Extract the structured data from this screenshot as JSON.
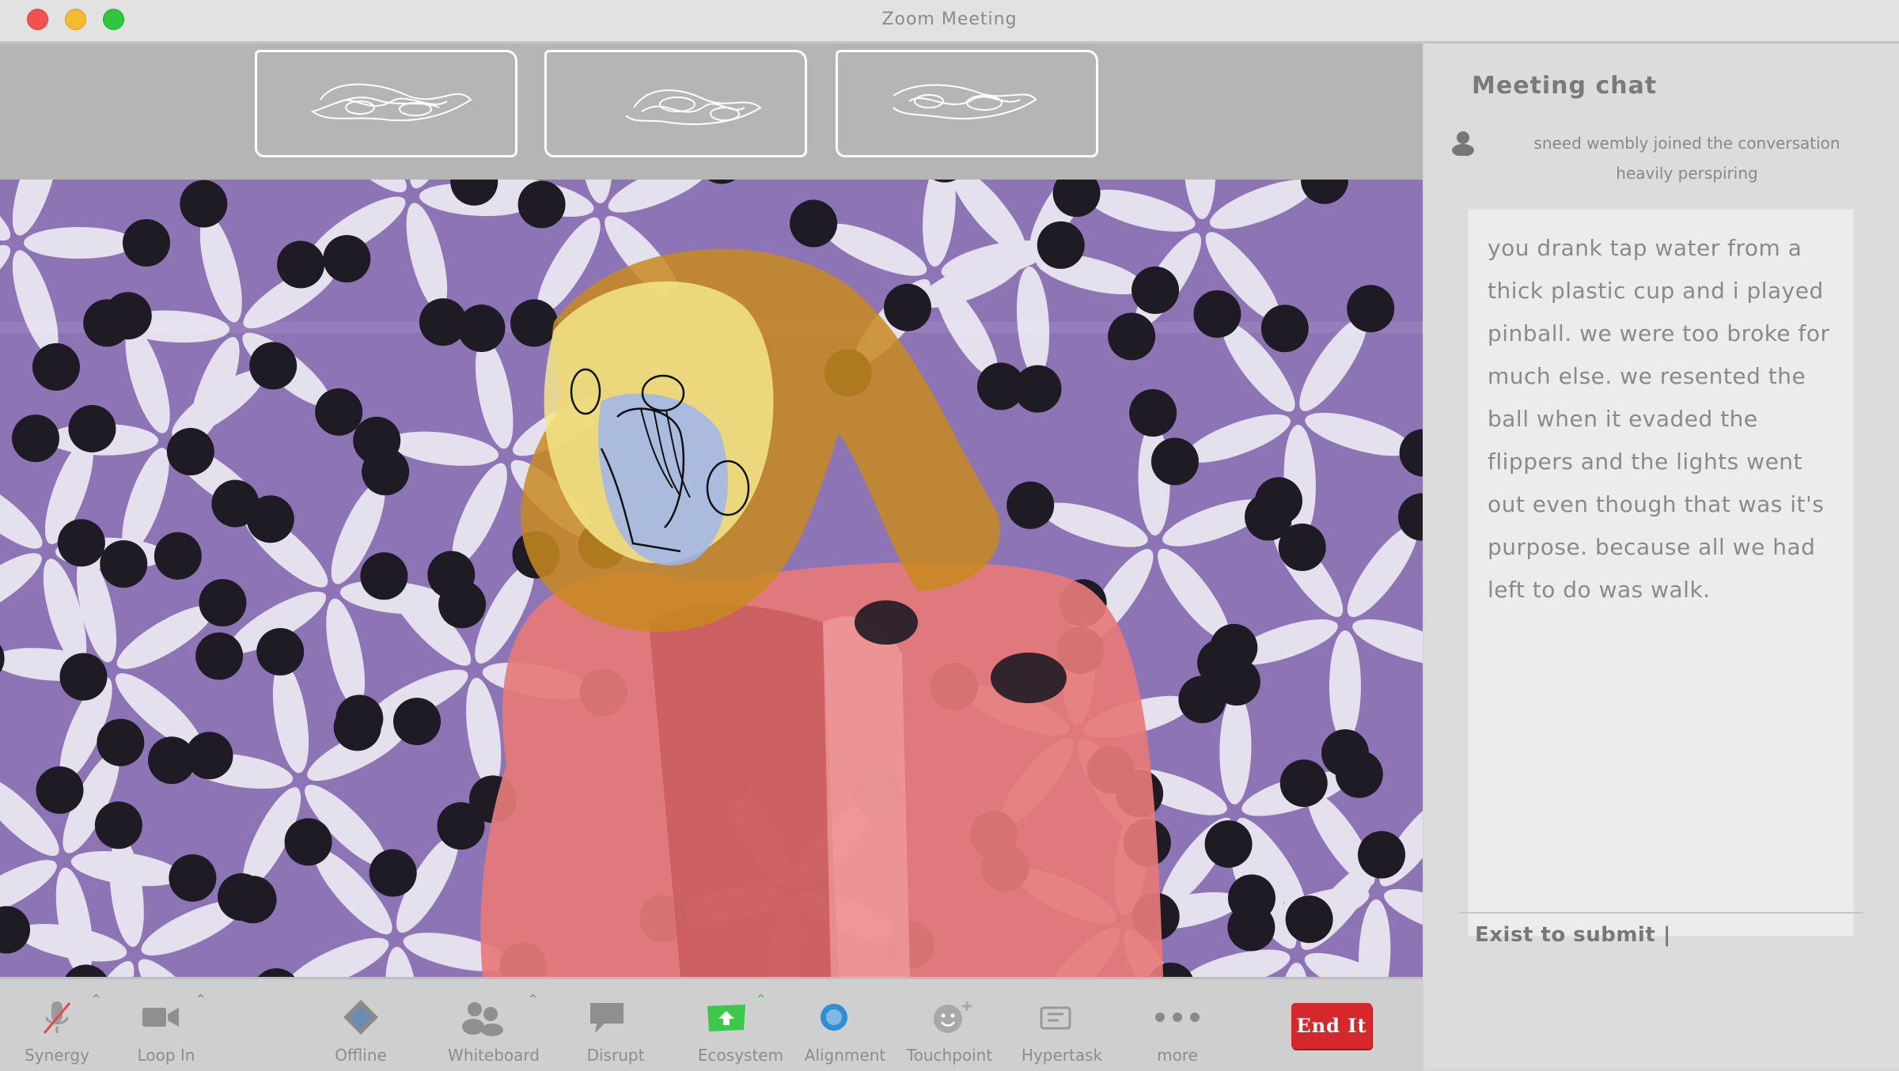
{
  "window": {
    "title": "Zoom Meeting"
  },
  "chat": {
    "title": "Meeting chat",
    "system_line1": "sneed wembly  joined the conversation",
    "system_line2": "heavily perspiring",
    "message": "you drank tap water from a thick plastic cup and i played pinball. we were too broke for much else. we resented the ball when it evaded the flippers and the lights went out even though that was it's purpose. because all we had left to do was walk.",
    "input_placeholder": "Exist to submit |"
  },
  "toolbar": {
    "synergy": "Synergy",
    "loop_in": "Loop In",
    "offline": "Offline",
    "whiteboard": "Whiteboard",
    "disrupt": "Disrupt",
    "ecosystem": "Ecosystem",
    "alignment": "Alignment",
    "touchpoint": "Touchpoint",
    "hypertask": "Hypertask",
    "more": "more",
    "end": "End It"
  },
  "colors": {
    "video_bg": "#8d74b4",
    "end_button": "#d6282c",
    "ecosystem_green": "#3cc94a",
    "alignment_blue": "#2f8fd0"
  },
  "icons": [
    "microphone-muted-icon",
    "video-camera-icon",
    "diamond-icon",
    "people-icon",
    "speech-bubble-icon",
    "share-screen-icon",
    "circle-icon",
    "smiley-add-icon",
    "hypertask-icon",
    "ellipsis-icon",
    "caret-up-icon"
  ]
}
